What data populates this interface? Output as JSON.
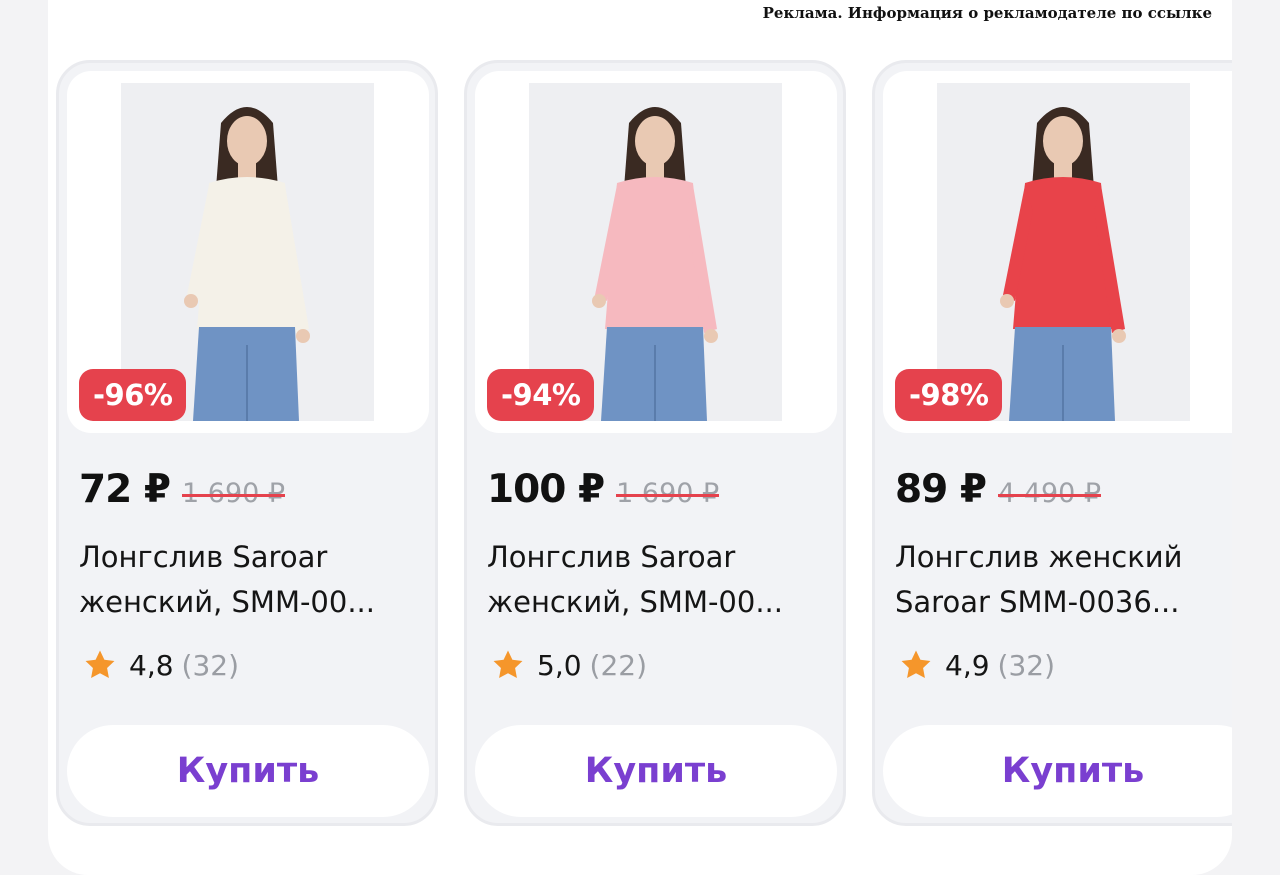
{
  "ad": {
    "disclaimer": "Реклама. Информация о рекламодателе по ссылке"
  },
  "products": [
    {
      "discount": "-96%",
      "price": "72 ₽",
      "old_price": "1 690 ₽",
      "title_line1": "Лонгслив Saroar",
      "title_line2": "женский, SMM-00...",
      "rating": "4,8",
      "reviews": "(32)",
      "buy_label": "Купить",
      "shirt_color": "#f4f1e8"
    },
    {
      "discount": "-94%",
      "price": "100 ₽",
      "old_price": "1 690 ₽",
      "title_line1": "Лонгслив Saroar",
      "title_line2": "женский, SMM-00...",
      "rating": "5,0",
      "reviews": "(22)",
      "buy_label": "Купить",
      "shirt_color": "#f6b9bf"
    },
    {
      "discount": "-98%",
      "price": "89 ₽",
      "old_price": "4 490 ₽",
      "title_line1": "Лонгслив женский",
      "title_line2": "Saroar SMM-0036...",
      "rating": "4,9",
      "reviews": "(32)",
      "buy_label": "Купить",
      "shirt_color": "#e8434a"
    }
  ],
  "colors": {
    "discount_badge": "#e5424d",
    "buy_text": "#7a3fd0",
    "star": "#f5962b",
    "jeans": "#6f93c4",
    "skin": "#e9c9b3",
    "hair": "#3a2a22"
  },
  "icons": {
    "rating": "star-icon"
  }
}
